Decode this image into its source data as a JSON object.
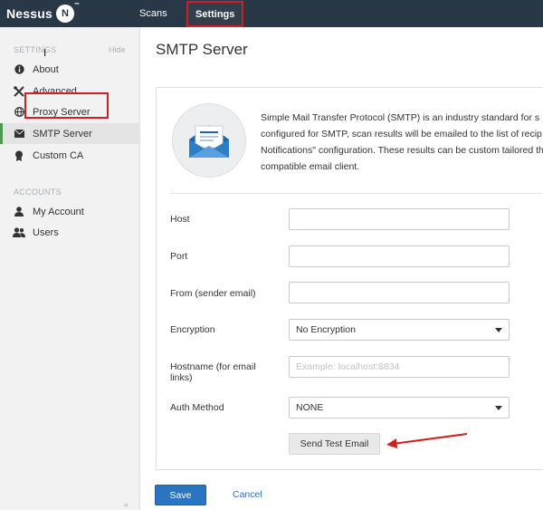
{
  "topbar": {
    "logo_text": "Nessus",
    "logo_badge": "N",
    "logo_tm": "™",
    "nav": {
      "scans": "Scans",
      "settings": "Settings"
    }
  },
  "sidebar": {
    "settings_header": "SETTINGS",
    "hide": "Hide",
    "settings_items": [
      {
        "label": "About",
        "icon": "info-icon"
      },
      {
        "label": "Advanced",
        "icon": "tools-icon"
      },
      {
        "label": "Proxy Server",
        "icon": "globe-icon"
      },
      {
        "label": "SMTP Server",
        "icon": "envelope-icon",
        "active": true
      },
      {
        "label": "Custom CA",
        "icon": "certificate-icon"
      }
    ],
    "accounts_header": "ACCOUNTS",
    "account_items": [
      {
        "label": "My Account",
        "icon": "user-icon"
      },
      {
        "label": "Users",
        "icon": "users-icon"
      }
    ],
    "collapse": "«"
  },
  "main": {
    "title": "SMTP Server",
    "intro_lines": [
      "Simple Mail Transfer Protocol (SMTP) is an industry standard for s",
      "configured for SMTP, scan results will be emailed to the list of recip",
      "Notifications\" configuration. These results can be custom tailored th",
      "compatible email client."
    ],
    "fields": {
      "host": {
        "label": "Host",
        "value": ""
      },
      "port": {
        "label": "Port",
        "value": ""
      },
      "from": {
        "label": "From (sender email)",
        "value": ""
      },
      "encryption": {
        "label": "Encryption",
        "value": "No Encryption"
      },
      "hostname": {
        "label_line1": "Hostname (for email",
        "label_line2": "links)",
        "value": "",
        "placeholder": "Example: localhost:8834"
      },
      "auth": {
        "label": "Auth Method",
        "value": "NONE"
      }
    },
    "test_button": "Send Test Email",
    "save_button": "Save",
    "cancel_link": "Cancel"
  },
  "colors": {
    "topbar": "#293846",
    "highlight": "#d21f1f",
    "primary": "#2a75c2",
    "active_indicator": "#4c9b4c"
  }
}
